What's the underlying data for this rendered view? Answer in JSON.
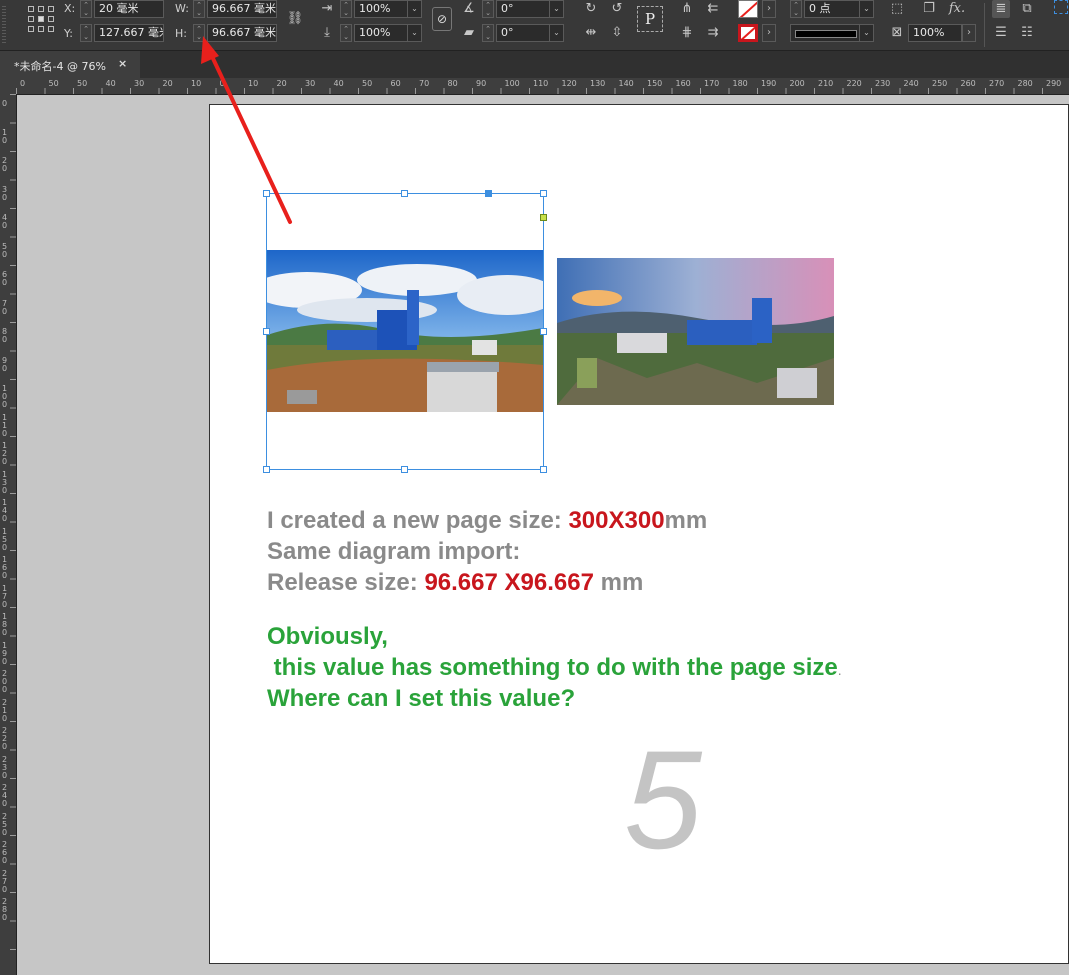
{
  "control": {
    "x_label": "X:",
    "x_value": "20 毫米",
    "y_label": "Y:",
    "y_value": "127.667 毫米",
    "w_label": "W:",
    "w_value": "96.667 毫米",
    "h_label": "H:",
    "h_value": "96.667 毫米",
    "scale_x": "100%",
    "scale_y": "100%",
    "rotate": "0°",
    "shear": "0°",
    "stroke_weight": "0 点",
    "opacity": "100%",
    "p_glyph": "P",
    "fx_label": "fx."
  },
  "tab": {
    "title": "*未命名-4 @ 76%",
    "close": "×"
  },
  "ruler": {
    "h_ticks": [
      "0",
      "50",
      "50",
      "40",
      "30",
      "20",
      "10",
      "0",
      "10",
      "20",
      "30",
      "40",
      "50",
      "60",
      "70",
      "80",
      "90",
      "100",
      "110",
      "120",
      "130",
      "140",
      "150",
      "160",
      "170",
      "180",
      "190",
      "200",
      "210",
      "220",
      "230",
      "240",
      "250",
      "260",
      "270",
      "280",
      "290"
    ],
    "v_ticks": [
      "0",
      "10",
      "20",
      "30",
      "40",
      "50",
      "60",
      "70",
      "80",
      "90",
      "100",
      "110",
      "120",
      "130",
      "140",
      "150",
      "160",
      "170",
      "180",
      "190",
      "200",
      "210",
      "220",
      "230",
      "240",
      "250",
      "260",
      "270",
      "280"
    ]
  },
  "content": {
    "line1_a": "I created a new page size: ",
    "line1_b": "300X300",
    "line1_c": "mm",
    "line2": "Same diagram import:",
    "line3_a": "Release size: ",
    "line3_b": "96.667 X96.667",
    "line3_c": " mm",
    "green1": "Obviously,",
    "green2": " this value has something to do with the page size",
    "green2_dot": ".",
    "green3": "Where can I set this value?"
  },
  "page_number": "5",
  "colors": {
    "accent_selection": "#3d8fe0",
    "annotation_arrow": "#e8201c",
    "red_text": "#c8161d",
    "green_text": "#2aa33a",
    "gray_text": "#8a8a8a"
  }
}
